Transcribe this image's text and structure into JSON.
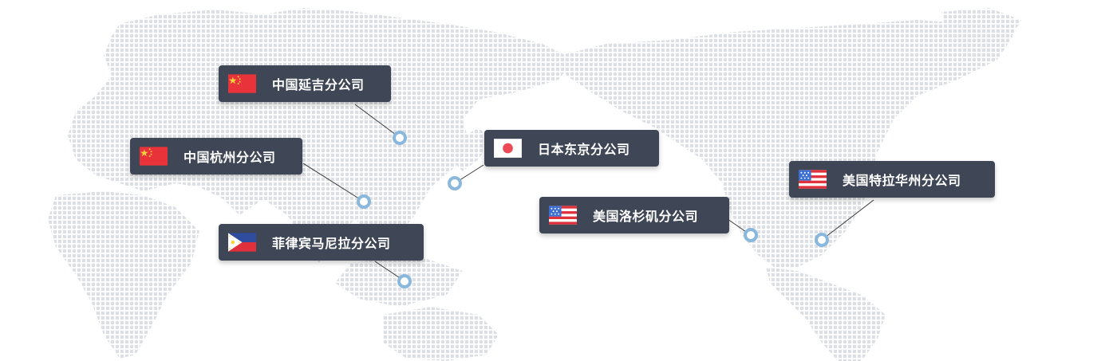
{
  "offices": [
    {
      "id": "yanji",
      "label": "中国延吉分公司",
      "flag": "china-flag-icon"
    },
    {
      "id": "hangzhou",
      "label": "中国杭州分公司",
      "flag": "china-flag-icon"
    },
    {
      "id": "manila",
      "label": "菲律宾马尼拉分公司",
      "flag": "philippines-flag-icon"
    },
    {
      "id": "tokyo",
      "label": "日本东京分公司",
      "flag": "japan-flag-icon"
    },
    {
      "id": "la",
      "label": "美国洛杉矶分公司",
      "flag": "usa-flag-icon"
    },
    {
      "id": "florida",
      "label": "美国特拉华州分公司",
      "flag": "usa-flag-icon"
    }
  ],
  "colors": {
    "label_bg": "#3f4655",
    "label_text": "#ffffff",
    "map_dots": "#dcdfe3",
    "marker_ring": "#8ab8dc",
    "connector": "#3a3a3a"
  }
}
